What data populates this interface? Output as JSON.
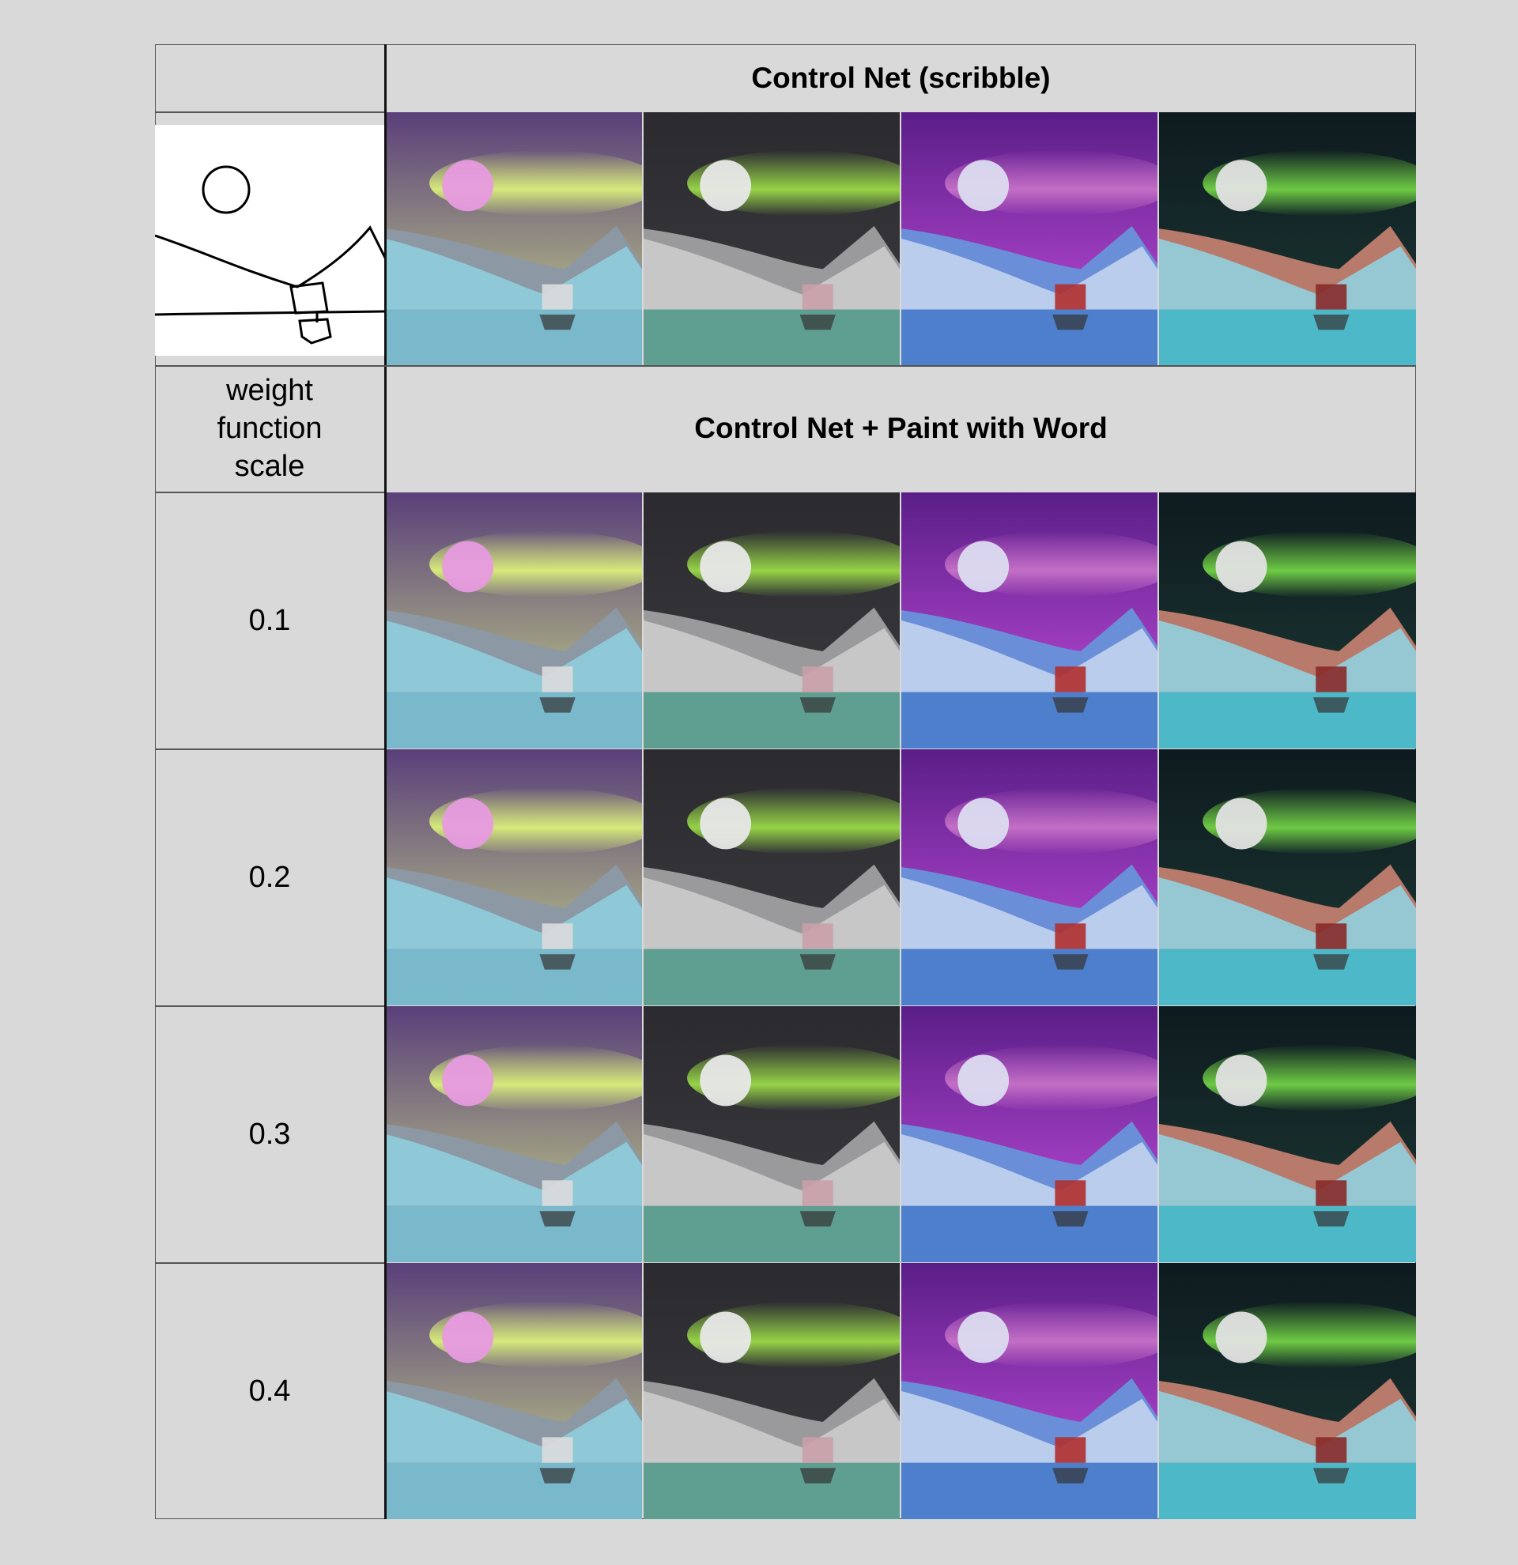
{
  "top_header": "Control Net (scribble)",
  "mid_header": "Control Net + Paint with Word",
  "row_label_lines": [
    "weight",
    "function",
    "scale"
  ],
  "scales": [
    "0.1",
    "0.2",
    "0.3",
    "0.4"
  ],
  "palettes": [
    {
      "sky_top": "#5a3f7a",
      "sky_bot": "#c9d98a",
      "aurora": "#e6ff7a",
      "moon": "#e79ae0",
      "mountain": "#8c98a3",
      "ice": "#8fd0e0",
      "water": "#7ab8cc",
      "boat": "#dcdcdc"
    },
    {
      "sky_top": "#2b2b2f",
      "sky_bot": "#3a3a40",
      "aurora": "#a8f04a",
      "moon": "#e8e8e8",
      "mountain": "#9a9a9c",
      "ice": "#cfcfcf",
      "water": "#5f9f92",
      "boat": "#c9a0a8"
    },
    {
      "sky_top": "#5a1e88",
      "sky_bot": "#c84fe0",
      "aurora": "#d07acc",
      "moon": "#dcdcf0",
      "mountain": "#6a8fd8",
      "ice": "#c8d8f0",
      "water": "#4d7fcc",
      "boat": "#b03030"
    },
    {
      "sky_top": "#0e1a1f",
      "sky_bot": "#1d3a35",
      "aurora": "#7ee84a",
      "moon": "#e2e2e2",
      "mountain": "#b87a6a",
      "ice": "#8fd6e6",
      "water": "#4db8c8",
      "boat": "#8a2a2a"
    }
  ]
}
